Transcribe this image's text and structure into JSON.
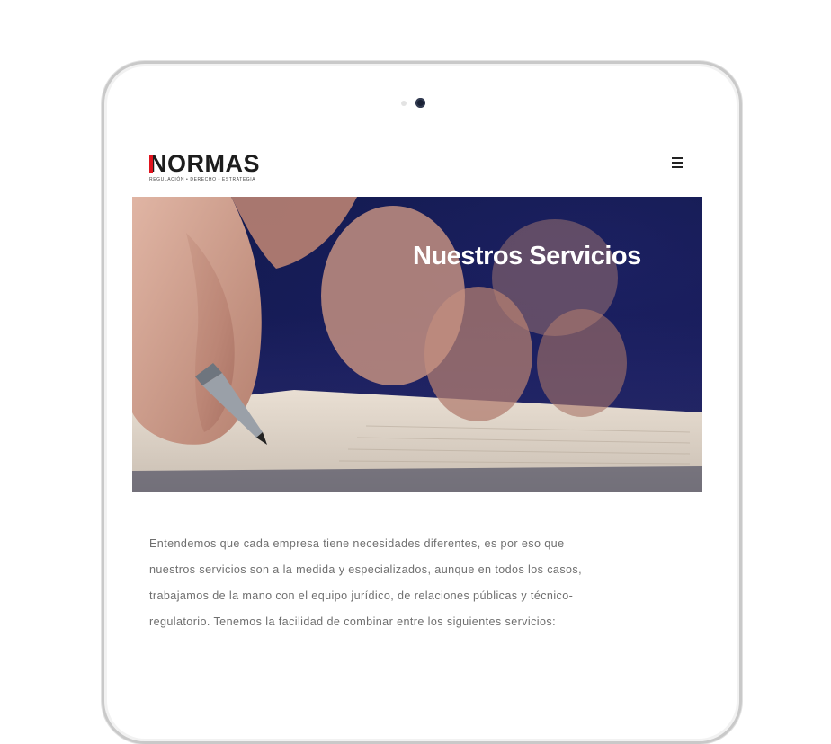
{
  "brand": {
    "name": "NORMAS",
    "tagline": "REGULACIÓN • DERECHO • ESTRATEGIA",
    "accent_color": "#e0141e"
  },
  "header": {
    "menu_icon": "hamburger-menu-icon"
  },
  "hero": {
    "title": "Nuestros Servicios",
    "background_color": "#151b55"
  },
  "intro": {
    "text": "Entendemos que cada empresa tiene necesidades diferentes, es por eso que nuestros servicios son a la medida y especializados, aunque en todos los casos, trabajamos de la mano con el equipo jurídico, de relaciones públicas y técnico-regulatorio. Tenemos la facilidad de combinar entre los siguientes servicios:"
  }
}
